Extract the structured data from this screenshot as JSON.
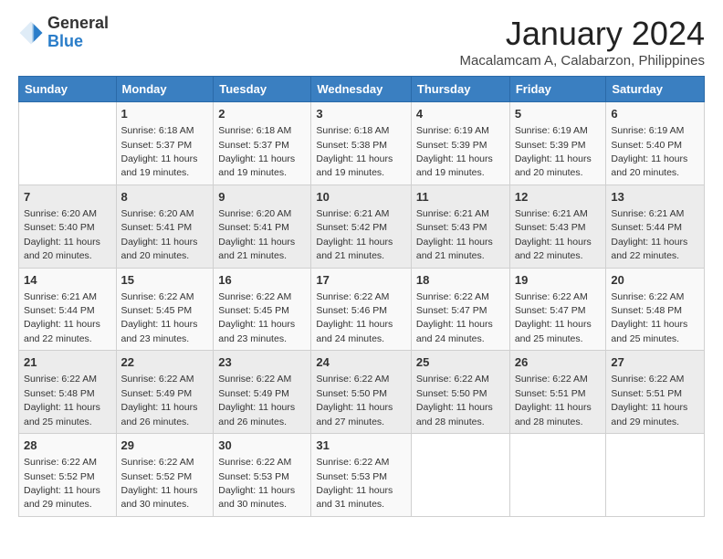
{
  "logo": {
    "general": "General",
    "blue": "Blue"
  },
  "header": {
    "month": "January 2024",
    "location": "Macalamcam A, Calabarzon, Philippines"
  },
  "days_of_week": [
    "Sunday",
    "Monday",
    "Tuesday",
    "Wednesday",
    "Thursday",
    "Friday",
    "Saturday"
  ],
  "weeks": [
    [
      {
        "day": "",
        "info": ""
      },
      {
        "day": "1",
        "info": "Sunrise: 6:18 AM\nSunset: 5:37 PM\nDaylight: 11 hours and 19 minutes."
      },
      {
        "day": "2",
        "info": "Sunrise: 6:18 AM\nSunset: 5:37 PM\nDaylight: 11 hours and 19 minutes."
      },
      {
        "day": "3",
        "info": "Sunrise: 6:18 AM\nSunset: 5:38 PM\nDaylight: 11 hours and 19 minutes."
      },
      {
        "day": "4",
        "info": "Sunrise: 6:19 AM\nSunset: 5:39 PM\nDaylight: 11 hours and 19 minutes."
      },
      {
        "day": "5",
        "info": "Sunrise: 6:19 AM\nSunset: 5:39 PM\nDaylight: 11 hours and 20 minutes."
      },
      {
        "day": "6",
        "info": "Sunrise: 6:19 AM\nSunset: 5:40 PM\nDaylight: 11 hours and 20 minutes."
      }
    ],
    [
      {
        "day": "7",
        "info": "Sunrise: 6:20 AM\nSunset: 5:40 PM\nDaylight: 11 hours and 20 minutes."
      },
      {
        "day": "8",
        "info": "Sunrise: 6:20 AM\nSunset: 5:41 PM\nDaylight: 11 hours and 20 minutes."
      },
      {
        "day": "9",
        "info": "Sunrise: 6:20 AM\nSunset: 5:41 PM\nDaylight: 11 hours and 21 minutes."
      },
      {
        "day": "10",
        "info": "Sunrise: 6:21 AM\nSunset: 5:42 PM\nDaylight: 11 hours and 21 minutes."
      },
      {
        "day": "11",
        "info": "Sunrise: 6:21 AM\nSunset: 5:43 PM\nDaylight: 11 hours and 21 minutes."
      },
      {
        "day": "12",
        "info": "Sunrise: 6:21 AM\nSunset: 5:43 PM\nDaylight: 11 hours and 22 minutes."
      },
      {
        "day": "13",
        "info": "Sunrise: 6:21 AM\nSunset: 5:44 PM\nDaylight: 11 hours and 22 minutes."
      }
    ],
    [
      {
        "day": "14",
        "info": "Sunrise: 6:21 AM\nSunset: 5:44 PM\nDaylight: 11 hours and 22 minutes."
      },
      {
        "day": "15",
        "info": "Sunrise: 6:22 AM\nSunset: 5:45 PM\nDaylight: 11 hours and 23 minutes."
      },
      {
        "day": "16",
        "info": "Sunrise: 6:22 AM\nSunset: 5:45 PM\nDaylight: 11 hours and 23 minutes."
      },
      {
        "day": "17",
        "info": "Sunrise: 6:22 AM\nSunset: 5:46 PM\nDaylight: 11 hours and 24 minutes."
      },
      {
        "day": "18",
        "info": "Sunrise: 6:22 AM\nSunset: 5:47 PM\nDaylight: 11 hours and 24 minutes."
      },
      {
        "day": "19",
        "info": "Sunrise: 6:22 AM\nSunset: 5:47 PM\nDaylight: 11 hours and 25 minutes."
      },
      {
        "day": "20",
        "info": "Sunrise: 6:22 AM\nSunset: 5:48 PM\nDaylight: 11 hours and 25 minutes."
      }
    ],
    [
      {
        "day": "21",
        "info": "Sunrise: 6:22 AM\nSunset: 5:48 PM\nDaylight: 11 hours and 25 minutes."
      },
      {
        "day": "22",
        "info": "Sunrise: 6:22 AM\nSunset: 5:49 PM\nDaylight: 11 hours and 26 minutes."
      },
      {
        "day": "23",
        "info": "Sunrise: 6:22 AM\nSunset: 5:49 PM\nDaylight: 11 hours and 26 minutes."
      },
      {
        "day": "24",
        "info": "Sunrise: 6:22 AM\nSunset: 5:50 PM\nDaylight: 11 hours and 27 minutes."
      },
      {
        "day": "25",
        "info": "Sunrise: 6:22 AM\nSunset: 5:50 PM\nDaylight: 11 hours and 28 minutes."
      },
      {
        "day": "26",
        "info": "Sunrise: 6:22 AM\nSunset: 5:51 PM\nDaylight: 11 hours and 28 minutes."
      },
      {
        "day": "27",
        "info": "Sunrise: 6:22 AM\nSunset: 5:51 PM\nDaylight: 11 hours and 29 minutes."
      }
    ],
    [
      {
        "day": "28",
        "info": "Sunrise: 6:22 AM\nSunset: 5:52 PM\nDaylight: 11 hours and 29 minutes."
      },
      {
        "day": "29",
        "info": "Sunrise: 6:22 AM\nSunset: 5:52 PM\nDaylight: 11 hours and 30 minutes."
      },
      {
        "day": "30",
        "info": "Sunrise: 6:22 AM\nSunset: 5:53 PM\nDaylight: 11 hours and 30 minutes."
      },
      {
        "day": "31",
        "info": "Sunrise: 6:22 AM\nSunset: 5:53 PM\nDaylight: 11 hours and 31 minutes."
      },
      {
        "day": "",
        "info": ""
      },
      {
        "day": "",
        "info": ""
      },
      {
        "day": "",
        "info": ""
      }
    ]
  ]
}
